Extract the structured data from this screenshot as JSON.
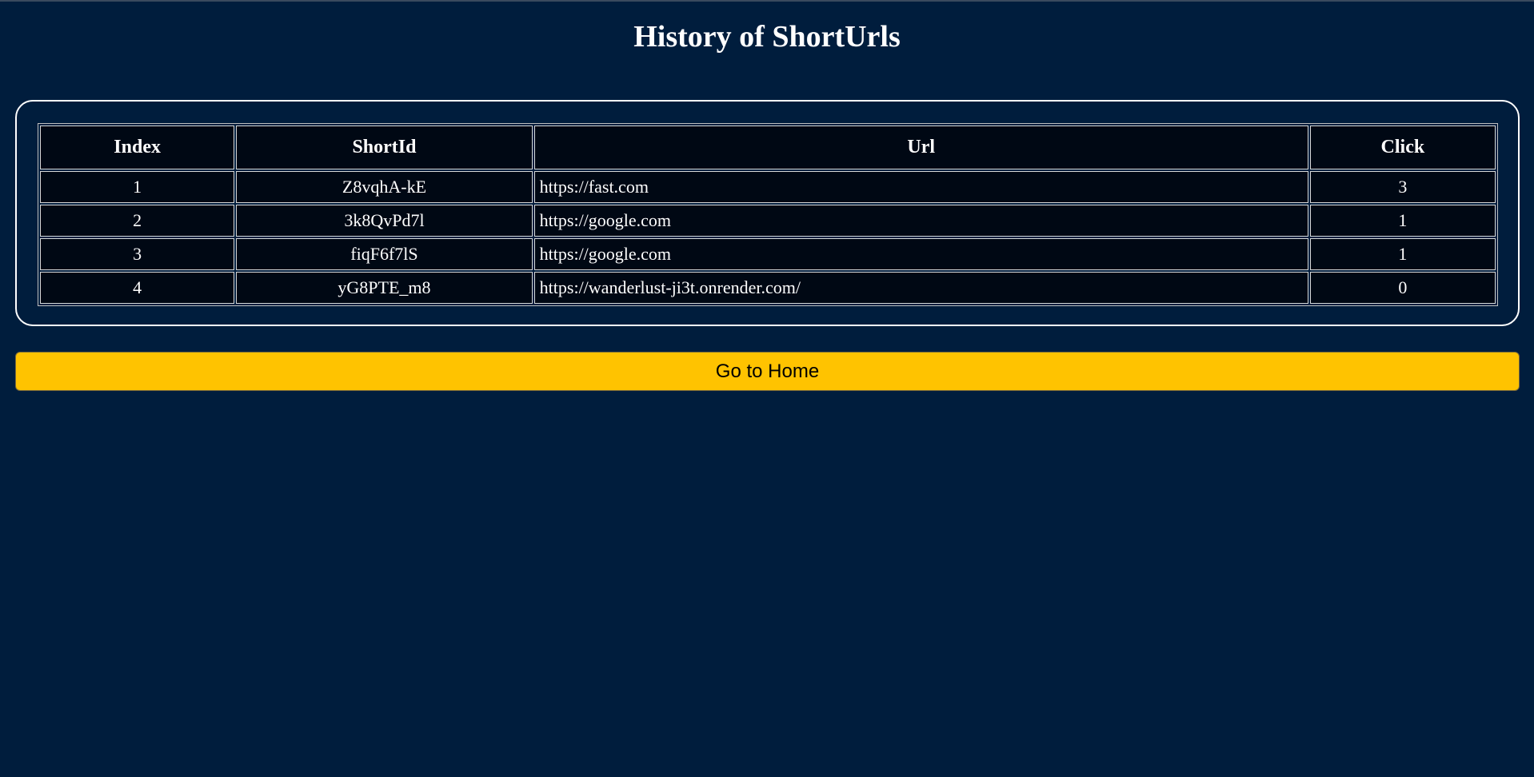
{
  "page": {
    "title": "History of ShortUrls"
  },
  "table": {
    "headers": [
      "Index",
      "ShortId",
      "Url",
      "Click"
    ],
    "rows": [
      {
        "index": "1",
        "short_id": "Z8vqhA-kE",
        "url": "https://fast.com",
        "clicks": "3"
      },
      {
        "index": "2",
        "short_id": "3k8QvPd7l",
        "url": "https://google.com",
        "clicks": "1"
      },
      {
        "index": "3",
        "short_id": "fiqF6f7lS",
        "url": "https://google.com",
        "clicks": "1"
      },
      {
        "index": "4",
        "short_id": "yG8PTE_m8",
        "url": "https://wanderlust-ji3t.onrender.com/",
        "clicks": "0"
      }
    ]
  },
  "actions": {
    "home_label": "Go to Home"
  },
  "colors": {
    "background": "#001d3d",
    "cell_background": "#000814",
    "button_background": "#ffc300",
    "text": "#ffffff"
  }
}
